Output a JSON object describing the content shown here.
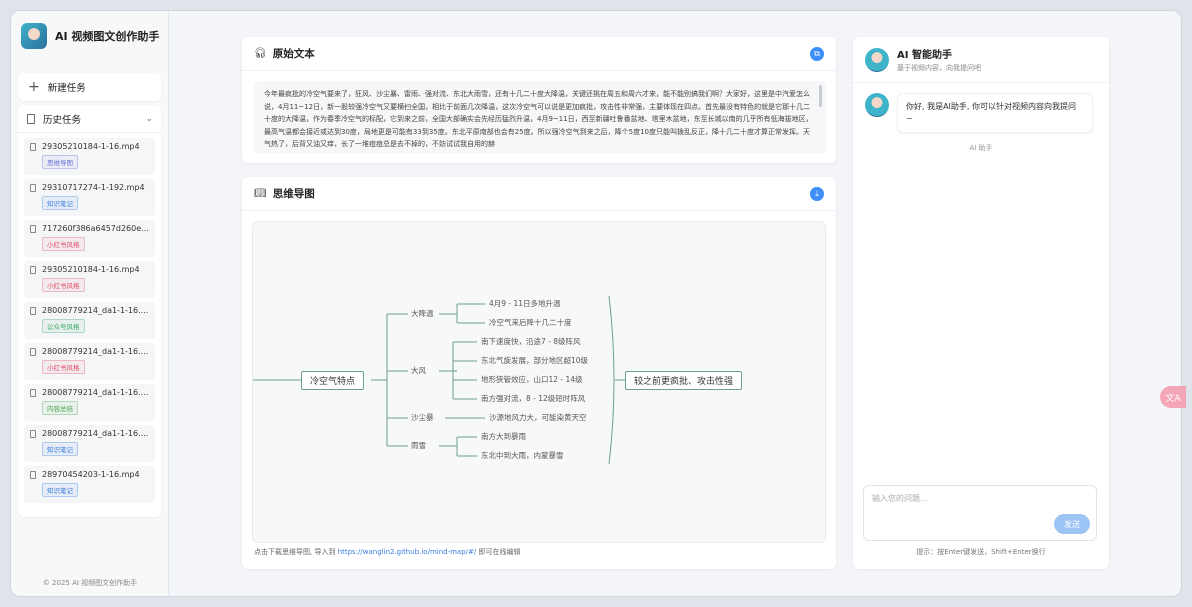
{
  "app": {
    "name": "AI 视频图文创作助手"
  },
  "sidebar": {
    "new_task": "新建任务",
    "history_label": "历史任务",
    "tasks": [
      {
        "name": "29305210184-1-16.mp4",
        "tag": "思维导图",
        "tag_color": "#6b6fd6"
      },
      {
        "name": "29310717274-1-192.mp4",
        "tag": "知识笔记",
        "tag_color": "#3b7ddd"
      },
      {
        "name": "717260f386a6457d260e...",
        "tag": "小红书风格",
        "tag_color": "#e0506b"
      },
      {
        "name": "29305210184-1-16.mp4",
        "tag": "小红书风格",
        "tag_color": "#e0506b"
      },
      {
        "name": "28008779214_da1-1-16....",
        "tag": "公众号风格",
        "tag_color": "#3aa86a"
      },
      {
        "name": "28008779214_da1-1-16....",
        "tag": "小红书风格",
        "tag_color": "#e0506b"
      },
      {
        "name": "28008779214_da1-1-16....",
        "tag": "内容总结",
        "tag_color": "#4aa84a"
      },
      {
        "name": "28008779214_da1-1-16....",
        "tag": "知识笔记",
        "tag_color": "#3b7ddd"
      },
      {
        "name": "28970454203-1-16.mp4",
        "tag": "知识笔记",
        "tag_color": "#3b7ddd"
      }
    ],
    "copyright": "© 2025 AI 视频图文创作助手"
  },
  "source": {
    "title": "原始文本",
    "text": "今年最疯批的冷空气要来了，狂风、沙尘暴、雷雨、强对流、东北大雨雪，还有十几二十度大降温，关键还挑在周五和周六才来，能不能别搞我们啊？大家好，这里是中汽爱怎么说，4月11~12日，新一股较强冷空气又要横扫全国，相比于前面几次降温，这次冷空气可以说是更加疯批，攻击性非常强，主要体现在四点。首先最没有特色的就是它那十几二十度的大降温，作为春季冷空气的标配，它到来之前，全国大部确实会先经历猛烈升温，4月9~11日，西至新疆吐鲁番盆地、塔里木盆地，东至长城以南的几乎所有低海拔地区，最高气温都会接近或达到30度，局地更是可能有33到35度。东北平原南部也会有25度。所以强冷空气到来之后，降个5度10度只能叫拨乱反正，降十几二十度才算正常发挥。天气热了，后背又油又痒，长了一堆痘痘总是去不掉的，不妨试试我自用的赫"
  },
  "mindmap": {
    "title": "思维导图",
    "root": "冷空气特点",
    "conclusion": "较之前更疯批、攻击性强",
    "branches": [
      {
        "label": "大降温",
        "leaves": [
          "4月9 - 11日多地升温",
          "冷空气来后降十几二十度"
        ]
      },
      {
        "label": "大风",
        "leaves": [
          "南下速度快，沿途7 - 8级阵风",
          "东北气旋发展，部分地区超10级",
          "地形狭管效应，山口12 - 14级",
          "南方强对流，8 - 12级短时阵风"
        ]
      },
      {
        "label": "沙尘暴",
        "leaves": [
          "沙源地风力大，可能染黄天空"
        ]
      },
      {
        "label": "雨雪",
        "leaves": [
          "南方大到暴雨",
          "东北中到大雨，内蒙暴雪"
        ]
      }
    ],
    "hint_prefix": "点击下载思维导图, 导入到 ",
    "hint_link": "https://wanglin2.github.io/mind-map/#/",
    "hint_suffix": " 即可在线编辑"
  },
  "chat": {
    "title": "AI 智能助手",
    "subtitle": "基于视频内容，向我提问吧",
    "greeting": "你好, 我是AI助手, 你可以针对视频内容向我提问 ~",
    "sender": "AI 助手",
    "input_placeholder": "输入您的问题...",
    "send": "发送",
    "hint": "提示：按Enter键发送，Shift+Enter换行"
  }
}
